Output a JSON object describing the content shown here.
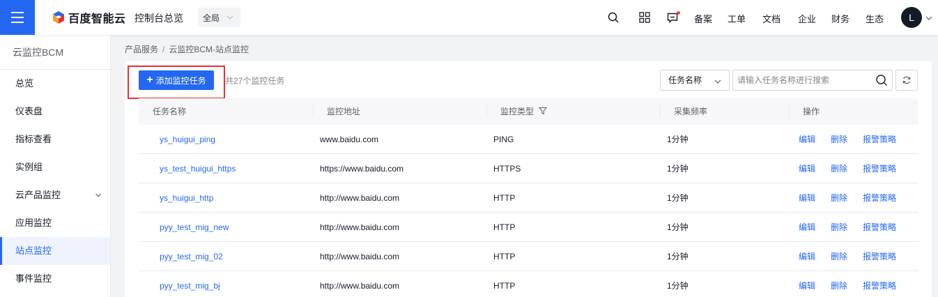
{
  "header": {
    "brand": "百度智能云",
    "console_title": "控制台总览",
    "region": "全局",
    "nav_links": [
      "备案",
      "工单",
      "文档",
      "企业",
      "财务",
      "生态"
    ],
    "avatar_initial": "L",
    "icons": [
      "search-icon",
      "grid-icon",
      "message-icon"
    ]
  },
  "sidebar": {
    "title": "云监控BCM",
    "items": [
      {
        "label": "总览"
      },
      {
        "label": "仪表盘"
      },
      {
        "label": "指标查看"
      },
      {
        "label": "实例组"
      },
      {
        "label": "云产品监控"
      },
      {
        "label": "应用监控"
      },
      {
        "label": "站点监控"
      },
      {
        "label": "事件监控"
      }
    ],
    "active_index": 6
  },
  "breadcrumb": {
    "parent": "产品服务",
    "separator": "/",
    "current": "云监控BCM-站点监控"
  },
  "toolbar": {
    "add_label": "添加监控任务",
    "count_text": "共27个监控任务",
    "filter_selected": "任务名称",
    "search_placeholder": "请输入任务名称进行搜索"
  },
  "table": {
    "columns": [
      "任务名称",
      "监控地址",
      "监控类型",
      "采集频率",
      "操作"
    ],
    "rows": [
      {
        "name": "ys_huigui_ping",
        "address": "www.baidu.com",
        "type": "PING",
        "frequency": "1分钟"
      },
      {
        "name": "ys_test_huigui_https",
        "address": "https://www.baidu.com",
        "type": "HTTPS",
        "frequency": "1分钟"
      },
      {
        "name": "ys_huigui_http",
        "address": "http://www.baidu.com",
        "type": "HTTP",
        "frequency": "1分钟"
      },
      {
        "name": "pyy_test_mig_new",
        "address": "http://www.baidu.com",
        "type": "HTTP",
        "frequency": "1分钟"
      },
      {
        "name": "pyy_test_mig_02",
        "address": "http://www.baidu.com",
        "type": "HTTP",
        "frequency": "1分钟"
      },
      {
        "name": "pyy_test_mig_bj",
        "address": "http://www.baidu.com",
        "type": "HTTP",
        "frequency": "1分钟"
      }
    ],
    "actions": {
      "edit": "编辑",
      "delete": "删除",
      "alarm": "报警策略"
    }
  },
  "colors": {
    "accent": "#2468f2",
    "highlight": "#e4303a",
    "notification": "#f33e3e"
  }
}
